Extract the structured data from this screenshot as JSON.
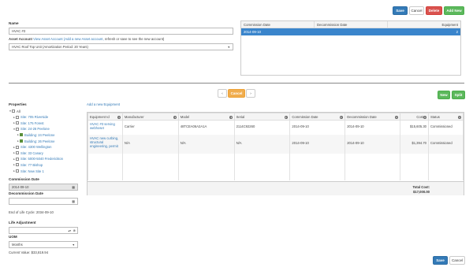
{
  "toolbar": {
    "save": "Save",
    "cancel": "Cancel",
    "delete": "Delete",
    "add_new": "Add New"
  },
  "form": {
    "name_label": "Name",
    "name_value": "HVAC #3",
    "asset_account_label": "Asset Account",
    "asset_view_link": "View Asset Account",
    "asset_add_link": "(Add a new Asset account,",
    "asset_add_suffix": "refresh or save to see the new account)",
    "asset_account_value": "HVAC Roof Top Unit (Amortization Period: 20 Years)"
  },
  "top_grid": {
    "headers": [
      "Commission Date",
      "Decommission Date",
      "Equipment"
    ],
    "row": {
      "commission": "2014-09-10",
      "decommission": "",
      "equipment": "2"
    }
  },
  "pager": {
    "prev": "‹",
    "current": "Cancel",
    "next": "›"
  },
  "section_buttons": {
    "new": "New",
    "split": "Split"
  },
  "properties": {
    "title": "Properties",
    "tree": [
      {
        "label": "All",
        "level": 0,
        "link": false,
        "checked": false,
        "caret": "▾"
      },
      {
        "label": "Site: 705 Riverside",
        "level": 1,
        "link": true,
        "checked": false,
        "caret": "▸"
      },
      {
        "label": "Site: 175 Forest",
        "level": 1,
        "link": true,
        "checked": false,
        "caret": "▸"
      },
      {
        "label": "Site: 24-26 Peelone",
        "level": 1,
        "link": true,
        "checked": false,
        "caret": "▾"
      },
      {
        "label": "Building: 24 Peelone",
        "level": 2,
        "link": true,
        "checked": true,
        "caret": "▸"
      },
      {
        "label": "Building: 26 Peelone",
        "level": 2,
        "link": true,
        "checked": true,
        "caret": "▸"
      },
      {
        "label": "Site: 4300 Wellington",
        "level": 1,
        "link": true,
        "checked": false,
        "caret": "▸"
      },
      {
        "label": "Site: 33 Canary",
        "level": 1,
        "link": true,
        "checked": false,
        "caret": "▸"
      },
      {
        "label": "Site: 5000-5040 Frederickton",
        "level": 1,
        "link": true,
        "checked": false,
        "caret": "▸"
      },
      {
        "label": "Site: 77 Bishop",
        "level": 1,
        "link": true,
        "checked": false,
        "caret": "▸"
      },
      {
        "label": "Site: New Site 1",
        "level": 1,
        "link": true,
        "checked": false,
        "caret": "▸"
      }
    ],
    "commission_label": "Commission Date",
    "commission_value": "2014-09-10",
    "decommission_label": "Decommission Date",
    "decommission_value": "",
    "end_of_life": "End of Life Cycle: 2034-09-10",
    "life_adjustment_label": "Life Adjustment",
    "life_adjustment_value": "",
    "uom_label": "UOM",
    "uom_value": "Months",
    "current_value": "Current Value: $33,819.94"
  },
  "equipment": {
    "add_link": "Add a new Equipment",
    "headers": [
      "Equipment Id",
      "Manufacturer",
      "Model",
      "Serial",
      "Commission Date",
      "Decommission Date",
      "Cost",
      "Status"
    ],
    "rows": [
      {
        "id_line1": "HVAC #3 serving",
        "id_line2": "webhoset",
        "id_line3": "",
        "manufacturer": "Carrier",
        "model": "48TCEA06A2A1A",
        "serial": "2114C92260",
        "commission": "2014-09-10",
        "decommission": "2014-09-10",
        "cost": "$15,605.30",
        "status": "Commissioned"
      },
      {
        "id_line1": "HVAC new curbing,",
        "id_line2": "structural",
        "id_line3": "engineering, permit",
        "manufacturer": "N/A",
        "model": "N/A",
        "serial": "N/A",
        "commission": "2014-09-10",
        "decommission": "2014-09-10",
        "cost": "$1,394.70",
        "status": "Commissioned"
      }
    ],
    "total_label": "Total Cost:",
    "total_value": "$17,000.00"
  },
  "footer": {
    "save": "Save",
    "cancel": "Cancel"
  },
  "colors": {
    "primary": "#337ab7",
    "danger": "#d9534f",
    "success": "#5cb85c",
    "warning": "#f0ad4e"
  }
}
